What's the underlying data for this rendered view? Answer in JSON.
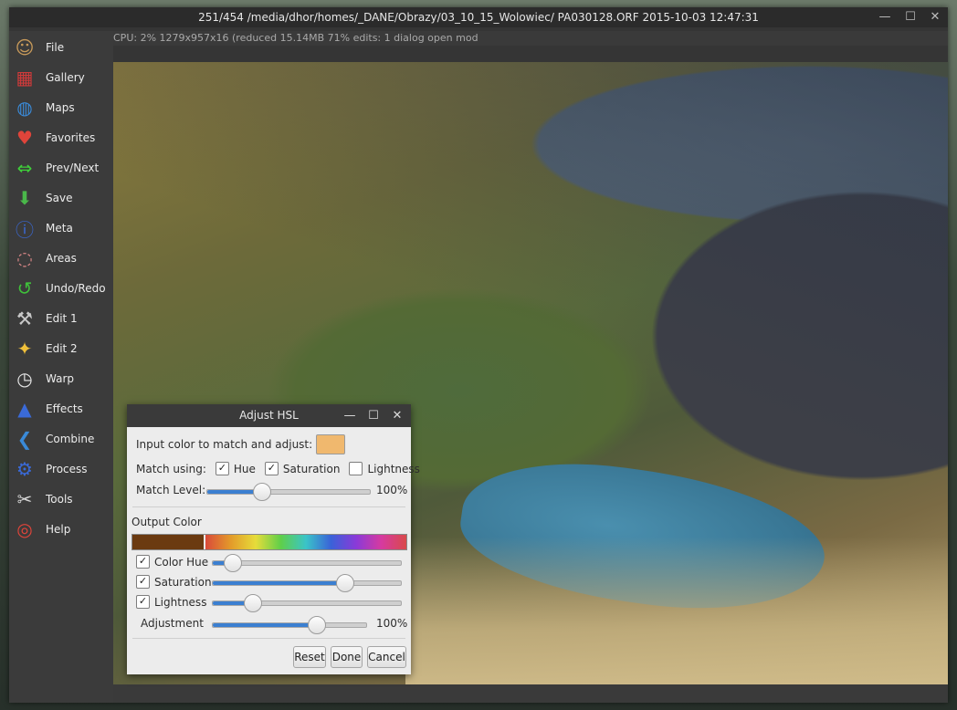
{
  "window": {
    "title": "251/454  /media/dhor/homes/_DANE/Obrazy/03_10_15_Wolowiec/  PA030128.ORF  2015-10-03 12:47:31",
    "status": "CPU: 2%  1279x957x16 (reduced  15.14MB  71%  edits: 1  dialog open  mod",
    "controls": {
      "minimize": "—",
      "maximize": "☐",
      "close": "✕"
    }
  },
  "sidebar": {
    "items": [
      {
        "label": "File",
        "icon": "portrait-icon",
        "glyph": "☺",
        "color": "#c89a5a"
      },
      {
        "label": "Gallery",
        "icon": "gallery-grid-icon",
        "glyph": "▦",
        "color": "#d03a3a"
      },
      {
        "label": "Maps",
        "icon": "globe-icon",
        "glyph": "◍",
        "color": "#3a8ad8"
      },
      {
        "label": "Favorites",
        "icon": "heart-icon",
        "glyph": "♥",
        "color": "#e0443a"
      },
      {
        "label": "Prev/Next",
        "icon": "double-arrow-icon",
        "glyph": "⇔",
        "color": "#3fcf3a"
      },
      {
        "label": "Save",
        "icon": "save-disk-icon",
        "glyph": "⬇",
        "color": "#4ab84a"
      },
      {
        "label": "Meta",
        "icon": "info-icon",
        "glyph": "ⓘ",
        "color": "#3a6ad8"
      },
      {
        "label": "Areas",
        "icon": "lasso-icon",
        "glyph": "◌",
        "color": "#e08a8a"
      },
      {
        "label": "Undo/Redo",
        "icon": "undo-redo-icon",
        "glyph": "↺",
        "color": "#3fbf3a"
      },
      {
        "label": "Edit 1",
        "icon": "hammer-icon",
        "glyph": "⚒",
        "color": "#c8c8c8"
      },
      {
        "label": "Edit 2",
        "icon": "magic-wand-icon",
        "glyph": "✦",
        "color": "#f0c03a"
      },
      {
        "label": "Warp",
        "icon": "clock-icon",
        "glyph": "◷",
        "color": "#e8e8e8"
      },
      {
        "label": "Effects",
        "icon": "wizard-hat-icon",
        "glyph": "▲",
        "color": "#3a6ad8"
      },
      {
        "label": "Combine",
        "icon": "combine-icon",
        "glyph": "❮",
        "color": "#3a8ad8"
      },
      {
        "label": "Process",
        "icon": "gear-icon",
        "glyph": "⚙",
        "color": "#3a6ad8"
      },
      {
        "label": "Tools",
        "icon": "tools-icon",
        "glyph": "✂",
        "color": "#d8d8d8"
      },
      {
        "label": "Help",
        "icon": "lifebuoy-icon",
        "glyph": "◎",
        "color": "#e0443a"
      }
    ]
  },
  "dialog": {
    "title": "Adjust HSL",
    "input_label": "Input color to match and adjust:",
    "input_color": "#f0b86e",
    "match_using_label": "Match using:",
    "match_options": [
      {
        "label": "Hue",
        "checked": true
      },
      {
        "label": "Saturation",
        "checked": true
      },
      {
        "label": "Lightness",
        "checked": false
      }
    ],
    "match_level_label": "Match Level:",
    "match_level_value": "100%",
    "match_level_fraction": 0.33,
    "output_label": "Output Color",
    "output_rows": [
      {
        "label": "Color Hue",
        "checked": true,
        "fraction": 0.1
      },
      {
        "label": "Saturation",
        "checked": true,
        "fraction": 0.7
      },
      {
        "label": "Lightness",
        "checked": true,
        "fraction": 0.21
      }
    ],
    "adjustment_label": "Adjustment",
    "adjustment_value": "100%",
    "adjustment_fraction": 0.67,
    "buttons": {
      "reset": "Reset",
      "done": "Done",
      "cancel": "Cancel"
    }
  }
}
